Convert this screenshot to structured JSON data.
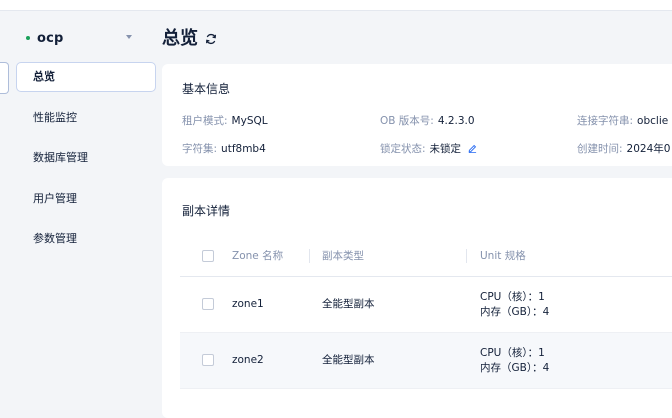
{
  "sidebar": {
    "tenant": {
      "name": "ocp",
      "status_color": "#1aa05a"
    },
    "items": [
      {
        "label": "总览",
        "active": true
      },
      {
        "label": "性能监控",
        "active": false
      },
      {
        "label": "数据库管理",
        "active": false
      },
      {
        "label": "用户管理",
        "active": false
      },
      {
        "label": "参数管理",
        "active": false
      }
    ]
  },
  "header": {
    "title": "总览",
    "refresh_icon": "refresh-icon"
  },
  "basic_info": {
    "title": "基本信息",
    "tenant_mode": {
      "label": "租户模式:",
      "value": "MySQL"
    },
    "ob_version": {
      "label": "OB 版本号:",
      "value": "4.2.3.0"
    },
    "conn_string": {
      "label": "连接字符串:",
      "value": "obclie"
    },
    "charset": {
      "label": "字符集:",
      "value": "utf8mb4"
    },
    "lock_status": {
      "label": "锁定状态:",
      "value": "未锁定"
    },
    "created_time": {
      "label": "创建时间:",
      "value": "2024年0"
    }
  },
  "replica_details": {
    "title": "副本详情",
    "columns": [
      "Zone 名称",
      "副本类型",
      "Unit 规格"
    ],
    "rows": [
      {
        "zone": "zone1",
        "type": "全能型副本",
        "cpu": "CPU（核）：1",
        "mem": "内存（GB）：4"
      },
      {
        "zone": "zone2",
        "type": "全能型副本",
        "cpu": "CPU（核）：1",
        "mem": "内存（GB）：4"
      }
    ]
  },
  "colors": {
    "accent": "#2468f2",
    "text": "#132039",
    "muted": "#8592ad",
    "background": "#f3f5f8"
  }
}
